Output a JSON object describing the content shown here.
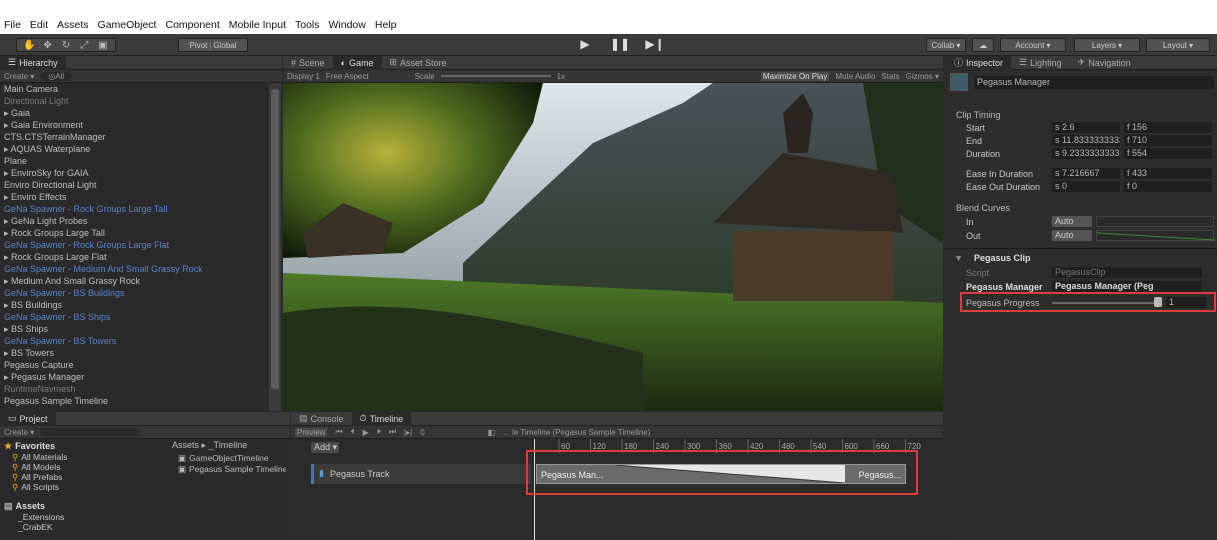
{
  "menu": [
    "File",
    "Edit",
    "Assets",
    "GameObject",
    "Component",
    "Mobile Input",
    "Tools",
    "Window",
    "Help"
  ],
  "toolbar": {
    "pivot": "Pivot",
    "global": "Global",
    "collab": "Collab ▾",
    "account": "Account ▾",
    "layers": "Layers ▾",
    "layout": "Layout ▾"
  },
  "hierarchy": {
    "tab": "Hierarchy",
    "create": "Create ▾",
    "search": "◎All",
    "items": [
      {
        "t": "Main Camera",
        "s": ""
      },
      {
        "t": "Directional Light",
        "s": "dim"
      },
      {
        "t": "▸ Gaia",
        "s": ""
      },
      {
        "t": "▸ Gaia Environment",
        "s": ""
      },
      {
        "t": "CTS.CTSTerrainManager",
        "s": ""
      },
      {
        "t": "▸ AQUAS Waterplane",
        "s": ""
      },
      {
        "t": "Plane",
        "s": ""
      },
      {
        "t": "▸ EnviroSky for GAIA",
        "s": ""
      },
      {
        "t": "Enviro Directional Light",
        "s": ""
      },
      {
        "t": "▸ Enviro Effects",
        "s": ""
      },
      {
        "t": "GeNa Spawner - Rock Groups Large Tall",
        "s": "blue"
      },
      {
        "t": "▸ GeNa Light Probes",
        "s": ""
      },
      {
        "t": "▸ Rock Groups Large Tall",
        "s": ""
      },
      {
        "t": "GeNa Spawner - Rock Groups Large Flat",
        "s": "blue"
      },
      {
        "t": "▸ Rock Groups Large Flat",
        "s": ""
      },
      {
        "t": "GeNa Spawner - Medium And Small Grassy Rock",
        "s": "blue"
      },
      {
        "t": "▸ Medium And Small Grassy Rock",
        "s": ""
      },
      {
        "t": "GeNa Spawner - BS Buildings",
        "s": "blue"
      },
      {
        "t": "▸ BS Buildings",
        "s": ""
      },
      {
        "t": "GeNa Spawner - BS Ships",
        "s": "blue"
      },
      {
        "t": "▸ BS Ships",
        "s": ""
      },
      {
        "t": "GeNa Spawner - BS Towers",
        "s": "blue"
      },
      {
        "t": "▸ BS Towers",
        "s": ""
      },
      {
        "t": "Pegasus Capture",
        "s": ""
      },
      {
        "t": "▸ Pegasus Manager",
        "s": ""
      },
      {
        "t": "RuntimeNavmesh",
        "s": "dim"
      },
      {
        "t": "Pegasus Sample Timeline",
        "s": ""
      }
    ]
  },
  "scene": {
    "tab_scene": "Scene",
    "tab_game": "Game",
    "tab_store": "Asset Store",
    "display": "Display 1",
    "aspect": "Free Aspect",
    "scale": "Scale",
    "scale_val": "1x",
    "maximize": "Maximize On Play",
    "mute": "Mute Audio",
    "stats": "Stats",
    "gizmos": "Gizmos ▾"
  },
  "inspector": {
    "tab_inspector": "Inspector",
    "tab_lighting": "Lighting",
    "tab_nav": "Navigation",
    "object": "Pegasus Manager",
    "clip_timing": "Clip Timing",
    "rows": [
      {
        "label": "Start",
        "s": "s 2.6",
        "f": "f 156"
      },
      {
        "label": "End",
        "s": "s 11.8333333333",
        "f": "f 710"
      },
      {
        "label": "Duration",
        "s": "s 9.23333333333",
        "f": "f 554"
      }
    ],
    "ease": [
      {
        "label": "Ease In Duration",
        "s": "s 7.216667",
        "f": "f 433"
      },
      {
        "label": "Ease Out Duration",
        "s": "s 0",
        "f": "f 0"
      }
    ],
    "blend": "Blend Curves",
    "in": "In",
    "out": "Out",
    "auto": "Auto",
    "clip": "Pegasus Clip",
    "script": "Script",
    "script_val": "PegasusClip",
    "manager": "Pegasus Manager",
    "manager_val": "Pegasus Manager (Peg",
    "progress": "Pegasus Progress",
    "progress_val": "1"
  },
  "project": {
    "tab": "Project",
    "create": "Create ▾",
    "favorites": "Favorites",
    "fav_items": [
      "All Materials",
      "All Models",
      "All Prefabs",
      "All Scripts"
    ],
    "assets": "Assets",
    "asset_items": [
      "_Extensions",
      "_CrabEK"
    ],
    "crumb": "Assets ▸ _Timeline",
    "files": [
      "GameObjectTimeline",
      "Pegasus Sample Timeline"
    ]
  },
  "timeline": {
    "tab_console": "Console",
    "tab_timeline": "Timeline",
    "preview": "Preview",
    "frame": "0",
    "title": "... le Timeline (Pegasus Sample Timeline)",
    "add": "Add ▾",
    "track": "Pegasus Track",
    "clip_left": "Pegasus Man...",
    "clip_right": "Pegasus...",
    "ruler": [
      "60",
      "120",
      "180",
      "240",
      "300",
      "360",
      "420",
      "480",
      "540",
      "600",
      "660",
      "720"
    ]
  }
}
